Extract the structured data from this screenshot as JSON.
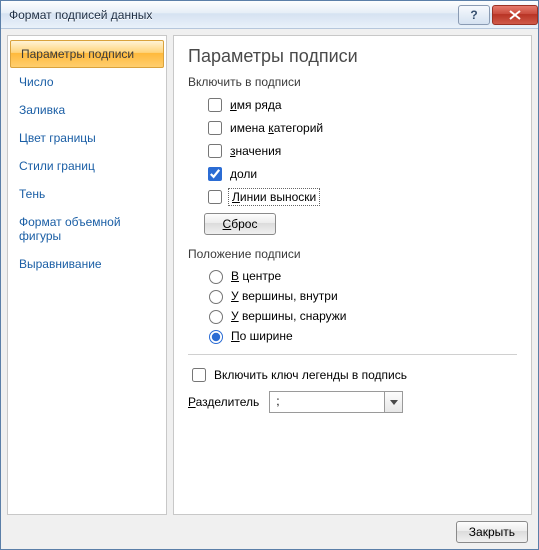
{
  "title": "Формат подписей данных",
  "sidebar": {
    "items": [
      {
        "label": "Параметры подписи",
        "active": true
      },
      {
        "label": "Число"
      },
      {
        "label": "Заливка"
      },
      {
        "label": "Цвет границы"
      },
      {
        "label": "Стили границ"
      },
      {
        "label": "Тень"
      },
      {
        "label": "Формат объемной фигуры"
      },
      {
        "label": "Выравнивание"
      }
    ]
  },
  "content": {
    "heading": "Параметры подписи",
    "include_group": "Включить в подписи",
    "opts": {
      "series": {
        "label": "имя ряда",
        "checked": false
      },
      "categories": {
        "label": "имена категорий",
        "checked": false
      },
      "values": {
        "label": "значения",
        "checked": false
      },
      "percentages": {
        "label": "доли",
        "checked": true
      },
      "leader_lines": {
        "label": "Линии выноски",
        "checked": false
      }
    },
    "reset": "Сброс",
    "position_group": "Положение подписи",
    "positions": {
      "center": {
        "label": "В центре"
      },
      "inside_end": {
        "label": "У вершины, внутри"
      },
      "outside_end": {
        "label": "У вершины, снаружи"
      },
      "best_fit": {
        "label": "По ширине",
        "selected": true
      }
    },
    "legend_key": {
      "label": "Включить ключ легенды в подпись",
      "checked": false
    },
    "separator_label": "Разделитель",
    "separator_value": ";"
  },
  "footer": {
    "close": "Закрыть"
  }
}
